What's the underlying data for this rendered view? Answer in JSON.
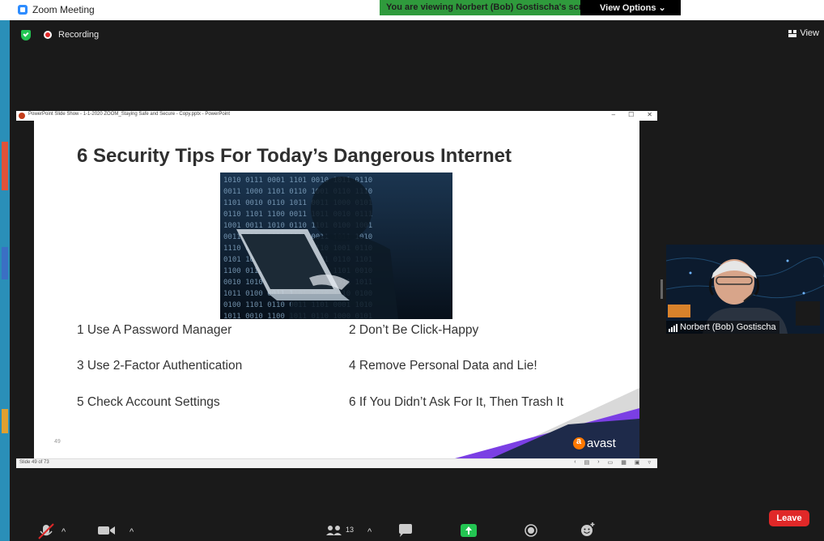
{
  "window": {
    "title": "Zoom Meeting"
  },
  "share_banner": {
    "message": "You are viewing Norbert (Bob) Gostischa's screen",
    "view_options": "View Options"
  },
  "meeting": {
    "recording_label": "Recording",
    "view_label": "View"
  },
  "ppt": {
    "window_title": "PowerPoint Slide Show - 1-1-2020 ZOOM_Staying Safe and Secure - Copy.pptx - PowerPoint",
    "status": "Slide 49 of 73"
  },
  "slide": {
    "title": "6 Security Tips For Today’s Dangerous Internet",
    "tips": [
      "1 Use A Password Manager",
      "2 Don’t Be Click-Happy",
      "3 Use 2-Factor Authentication",
      "4 Remove Personal Data and Lie!",
      "5 Check Account Settings",
      "6 If You Didn’t Ask For It, Then Trash It"
    ],
    "page_number": "49",
    "brand": "avast"
  },
  "video": {
    "participant_name": "Norbert (Bob) Gostischa"
  },
  "toolbar": {
    "participants_count": "13",
    "leave_label": "Leave"
  },
  "colors": {
    "zoom_blue": "#2d8cff",
    "share_green": "#2f9a3c",
    "leave_red": "#e02828",
    "avast_orange": "#ff7800",
    "slide_navy": "#1e2a4a",
    "slide_purple": "#7b3fe4"
  }
}
